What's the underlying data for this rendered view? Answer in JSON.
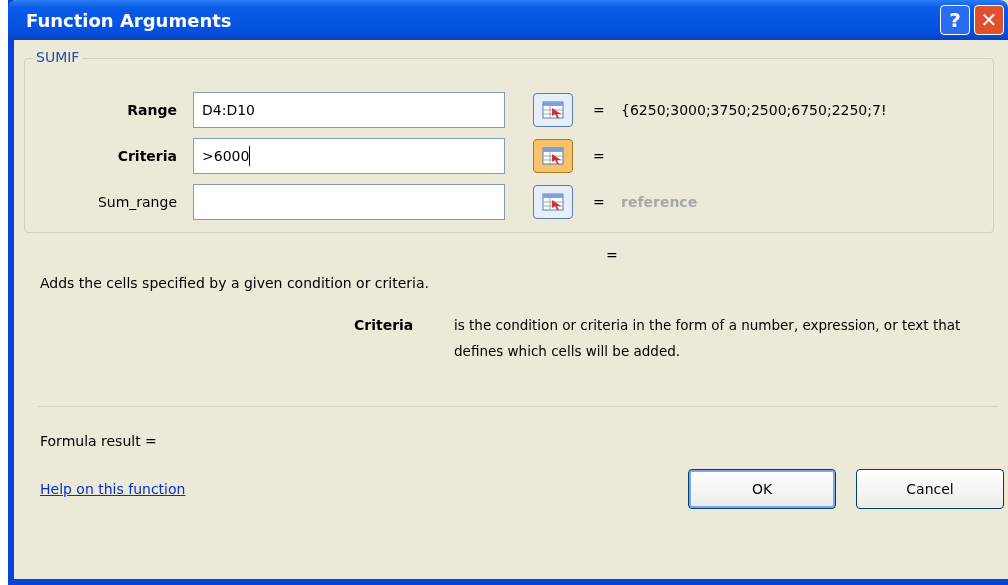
{
  "window": {
    "title": "Function Arguments",
    "buttons": [
      {
        "kind": "help",
        "label": "?"
      },
      {
        "kind": "close",
        "label": "✕"
      }
    ]
  },
  "function_group": {
    "name": "SUMIF",
    "arguments": [
      {
        "name": "Range",
        "required": true,
        "value": "D4:D10",
        "focused": false,
        "equals": "=",
        "result": "{6250;3000;3750;2500;6750;2250;7!",
        "result_is_hint": false
      },
      {
        "name": "Criteria",
        "required": true,
        "value": ">6000",
        "focused": true,
        "equals": "="
      },
      {
        "name": "Sum_range",
        "required": false,
        "focused": false,
        "equals": "=",
        "result": "reference",
        "result_is_hint": true
      }
    ]
  },
  "function_equals": "=",
  "description": "Adds the cells specified by a given condition or criteria.",
  "argument_help": {
    "name": "Criteria",
    "text": "is the condition or criteria in the form of a number, expression, or text that defines which cells will be added."
  },
  "formula_result": "Formula result =",
  "help_link": "Help on this function",
  "buttons": [
    {
      "label": "OK",
      "default": true
    },
    {
      "label": "Cancel",
      "default": false
    }
  ]
}
